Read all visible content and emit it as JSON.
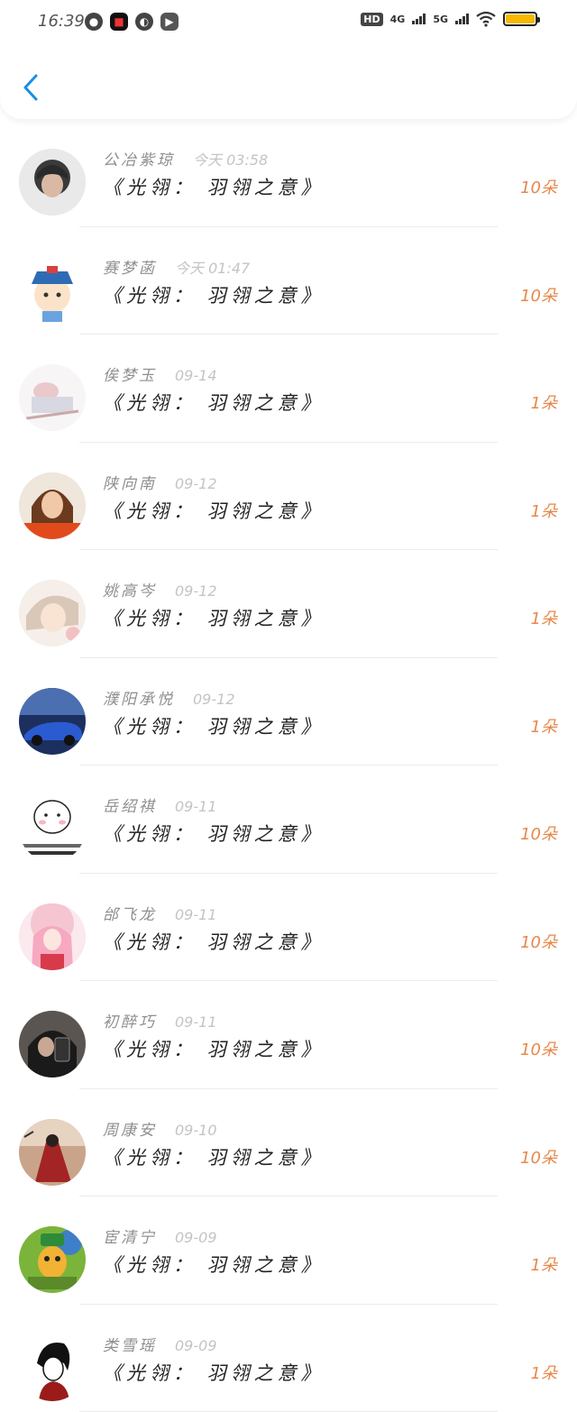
{
  "status_bar": {
    "time": "16:39",
    "hd": "HD",
    "net1": "4G",
    "net2": "5G"
  },
  "header": {
    "back_icon": "chevron-left-icon"
  },
  "list": [
    {
      "name": "公冶紫琼",
      "date": "今天 03:58",
      "title": "《光翎： 羽翎之意》",
      "amount": "10朵"
    },
    {
      "name": "赛梦菡",
      "date": "今天 01:47",
      "title": "《光翎： 羽翎之意》",
      "amount": "10朵"
    },
    {
      "name": "俟梦玉",
      "date": "09-14",
      "title": "《光翎： 羽翎之意》",
      "amount": "1朵"
    },
    {
      "name": "陕向南",
      "date": "09-12",
      "title": "《光翎： 羽翎之意》",
      "amount": "1朵"
    },
    {
      "name": "姚高岑",
      "date": "09-12",
      "title": "《光翎： 羽翎之意》",
      "amount": "1朵"
    },
    {
      "name": "濮阳承悦",
      "date": "09-12",
      "title": "《光翎： 羽翎之意》",
      "amount": "1朵"
    },
    {
      "name": "岳绍祺",
      "date": "09-11",
      "title": "《光翎： 羽翎之意》",
      "amount": "10朵"
    },
    {
      "name": "邰飞龙",
      "date": "09-11",
      "title": "《光翎： 羽翎之意》",
      "amount": "10朵"
    },
    {
      "name": "初醉巧",
      "date": "09-11",
      "title": "《光翎： 羽翎之意》",
      "amount": "10朵"
    },
    {
      "name": "周康安",
      "date": "09-10",
      "title": "《光翎： 羽翎之意》",
      "amount": "10朵"
    },
    {
      "name": "宦清宁",
      "date": "09-09",
      "title": "《光翎： 羽翎之意》",
      "amount": "1朵"
    },
    {
      "name": "类雪瑶",
      "date": "09-09",
      "title": "《光翎： 羽翎之意》",
      "amount": "1朵"
    }
  ]
}
